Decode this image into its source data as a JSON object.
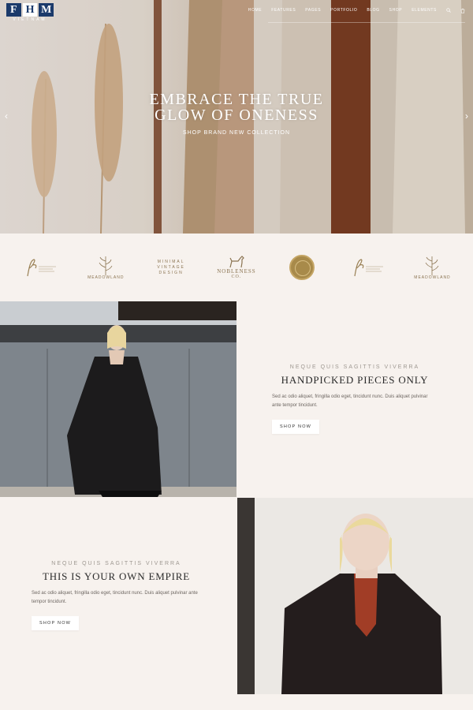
{
  "logo": {
    "letters": [
      "F",
      "H",
      "M"
    ],
    "subtitle": "VIETNAM"
  },
  "nav": {
    "items": [
      "Home",
      "Features",
      "Pages",
      "Portfolio",
      "Blog",
      "Shop",
      "Elements"
    ],
    "icons": [
      "search-icon",
      "cart-icon"
    ]
  },
  "hero": {
    "title_line1": "Embrace the true",
    "title_line2": "glow of oneness",
    "subtitle": "Shop brand new collection",
    "prev_arrow": "‹",
    "next_arrow": "›"
  },
  "brands": [
    {
      "type": "script",
      "mark": "fe",
      "text": "Company Name Yesterday"
    },
    {
      "type": "plant",
      "text": "Meadowland"
    },
    {
      "type": "stacked",
      "text": "Minimal Vintage Design"
    },
    {
      "type": "dog",
      "text": "Nobleness",
      "sub": "CO."
    },
    {
      "type": "seal",
      "text": ""
    },
    {
      "type": "script",
      "mark": "fe",
      "text": "Company Name Yesterday"
    },
    {
      "type": "plant",
      "text": "Meadowland"
    }
  ],
  "feature1": {
    "kicker": "Neque quis sagittis viverra",
    "title": "Handpicked pieces only",
    "body": "Sed ac odio aliquet, fringilla odio eget, tincidunt nunc. Duis aliquet pulvinar ante tempor tincidunt.",
    "button": "Shop now"
  },
  "feature2": {
    "kicker": "Neque quis sagittis viverra",
    "title": "This is your own empire",
    "body": "Sed ac odio aliquet, fringilla odio eget, tincidunt nunc. Duis aliquet pulvinar ante tempor tincidunt.",
    "button": "Shop now"
  },
  "colors": {
    "page_bg": "#f7f2ee",
    "brand_gold": "#9a8155",
    "logo_blue": "#1b3a6b"
  }
}
